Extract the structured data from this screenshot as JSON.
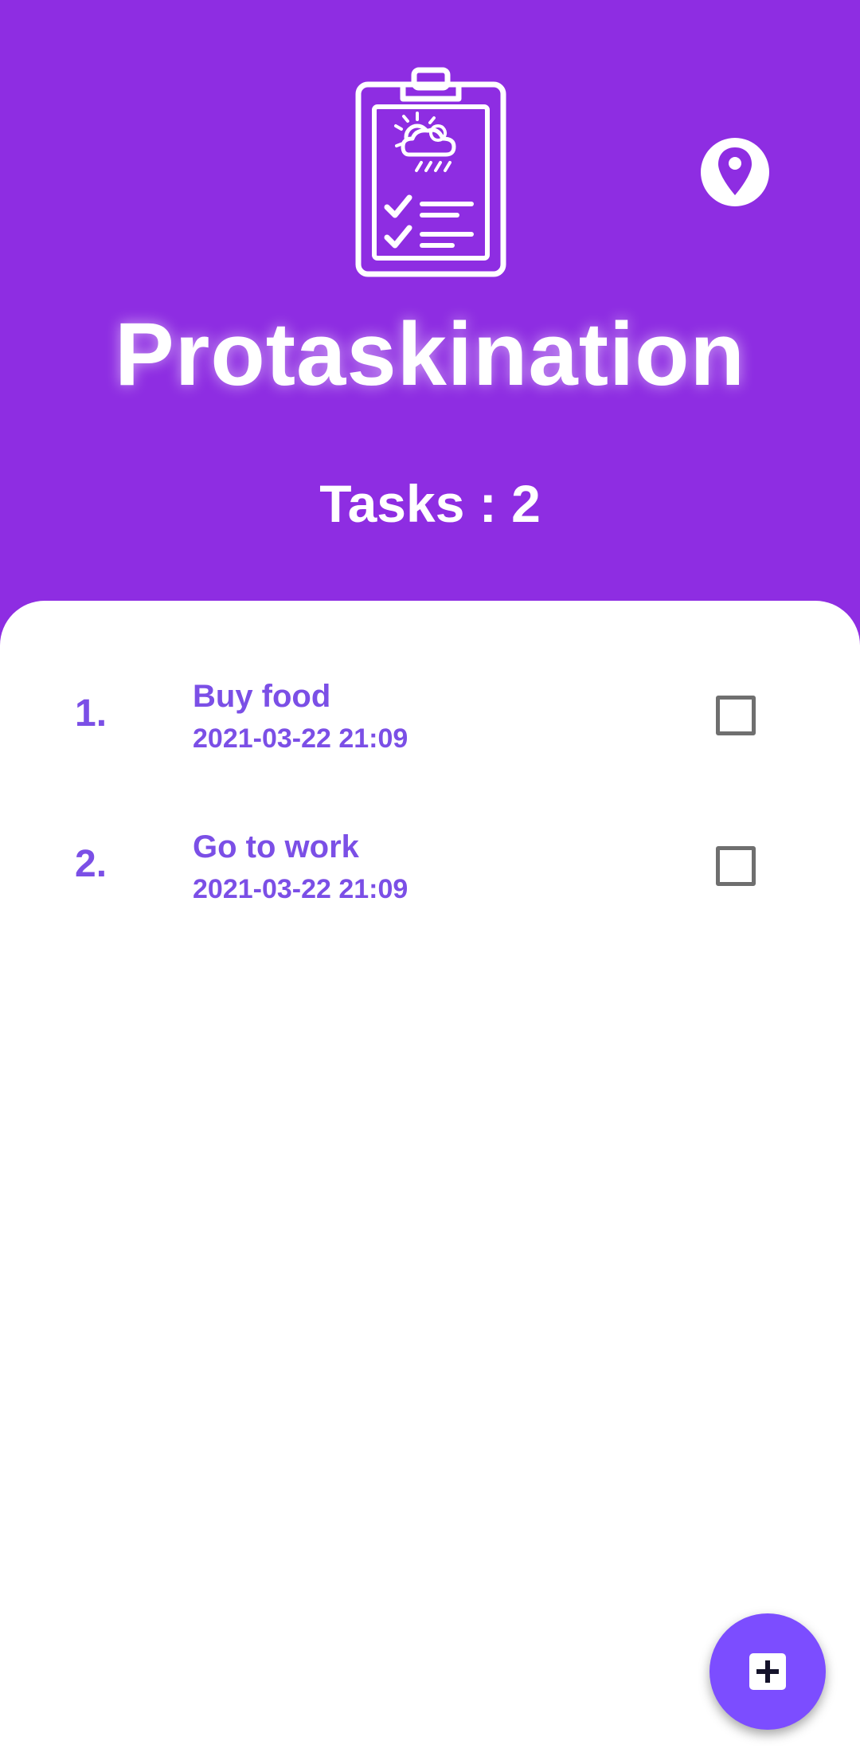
{
  "header": {
    "app_title": "Protaskination",
    "task_count_text": "Tasks : 2",
    "logo_icon": "clipboard-weather-icon",
    "location_icon": "location-pin-icon"
  },
  "tasks": [
    {
      "number": "1.",
      "title": "Buy food",
      "datetime": "2021-03-22 21:09",
      "checked": false
    },
    {
      "number": "2.",
      "title": "Go to work",
      "datetime": "2021-03-22 21:09",
      "checked": false
    }
  ],
  "fab": {
    "icon": "add-box-icon"
  },
  "colors": {
    "header_bg": "#8e2de2",
    "accent_text": "#7b4fe6",
    "fab_bg": "#7c4dff"
  }
}
